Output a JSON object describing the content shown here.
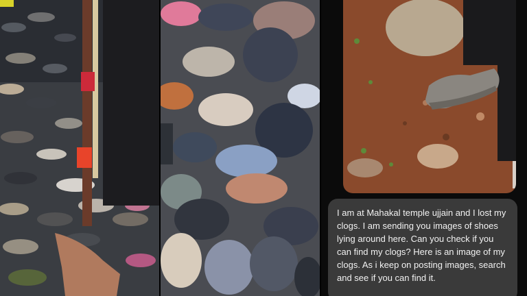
{
  "chat": {
    "message": "I am at Mahakal temple ujjain and I lost my clogs. I am sending you images of shoes lying around here. Can you check if you can find my clogs? Here is an image of my clogs. As i keep on posting images, search and see if you can find it."
  },
  "photos": {
    "left": {
      "icon": "shoe-pile-photo"
    },
    "middle": {
      "icon": "shoe-pile-closeup-photo"
    },
    "right": {
      "icon": "grey-clogs-on-ground-photo"
    }
  },
  "colors": {
    "background": "#111111",
    "bubble": "#3a3a3a",
    "bubble_text": "#f2f2f2",
    "soil": "#8a4a2c",
    "clog": "#8a8680"
  }
}
